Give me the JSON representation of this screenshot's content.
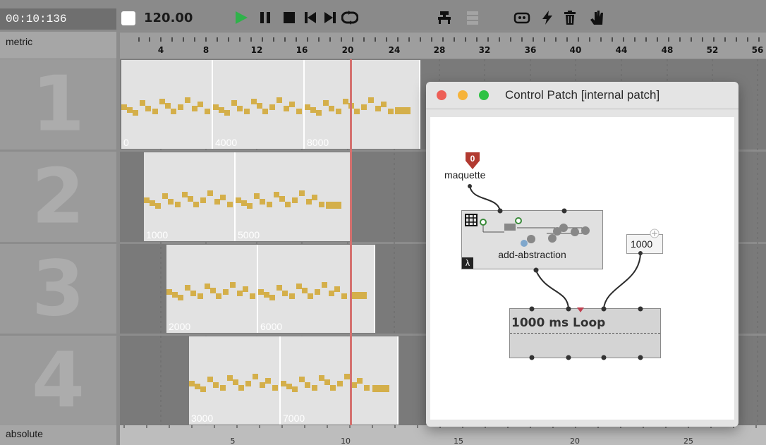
{
  "toolbar": {
    "time": "00:10:136",
    "tempo": "120.00",
    "icons": [
      "play-icon",
      "pause-icon",
      "stop-icon",
      "skip-back-icon",
      "skip-forward-icon",
      "loop-icon",
      "patch-icon",
      "layers-icon",
      "controller-icon",
      "lightning-icon",
      "trash-icon",
      "hand-icon"
    ],
    "accent": "#2fb24a"
  },
  "rulers": {
    "metric_label": "metric",
    "metric_ticks": [
      "4",
      "8",
      "12",
      "16",
      "20",
      "24",
      "28",
      "32",
      "36",
      "40",
      "44",
      "48",
      "52",
      "56"
    ],
    "absolute_label": "absolute",
    "absolute_ticks": [
      "5",
      "10",
      "15",
      "20",
      "25"
    ]
  },
  "tracks": [
    {
      "number": "1",
      "boxes": [
        "0",
        "4000",
        "8000"
      ]
    },
    {
      "number": "2",
      "boxes": [
        "1000",
        "5000"
      ]
    },
    {
      "number": "3",
      "boxes": [
        "2000",
        "6000"
      ]
    },
    {
      "number": "4",
      "boxes": [
        "3000",
        "7000"
      ]
    }
  ],
  "colors": {
    "note": "#d4af4a",
    "cursor": "#d4716f"
  },
  "control_patch": {
    "title": "Control Patch  [internal patch]",
    "input_badge": "0",
    "input_label": "maquette",
    "abstraction_label": "add-abstraction",
    "lambda_badge": "λ",
    "number_box": "1000",
    "loop_label": "1000 ms Loop"
  }
}
